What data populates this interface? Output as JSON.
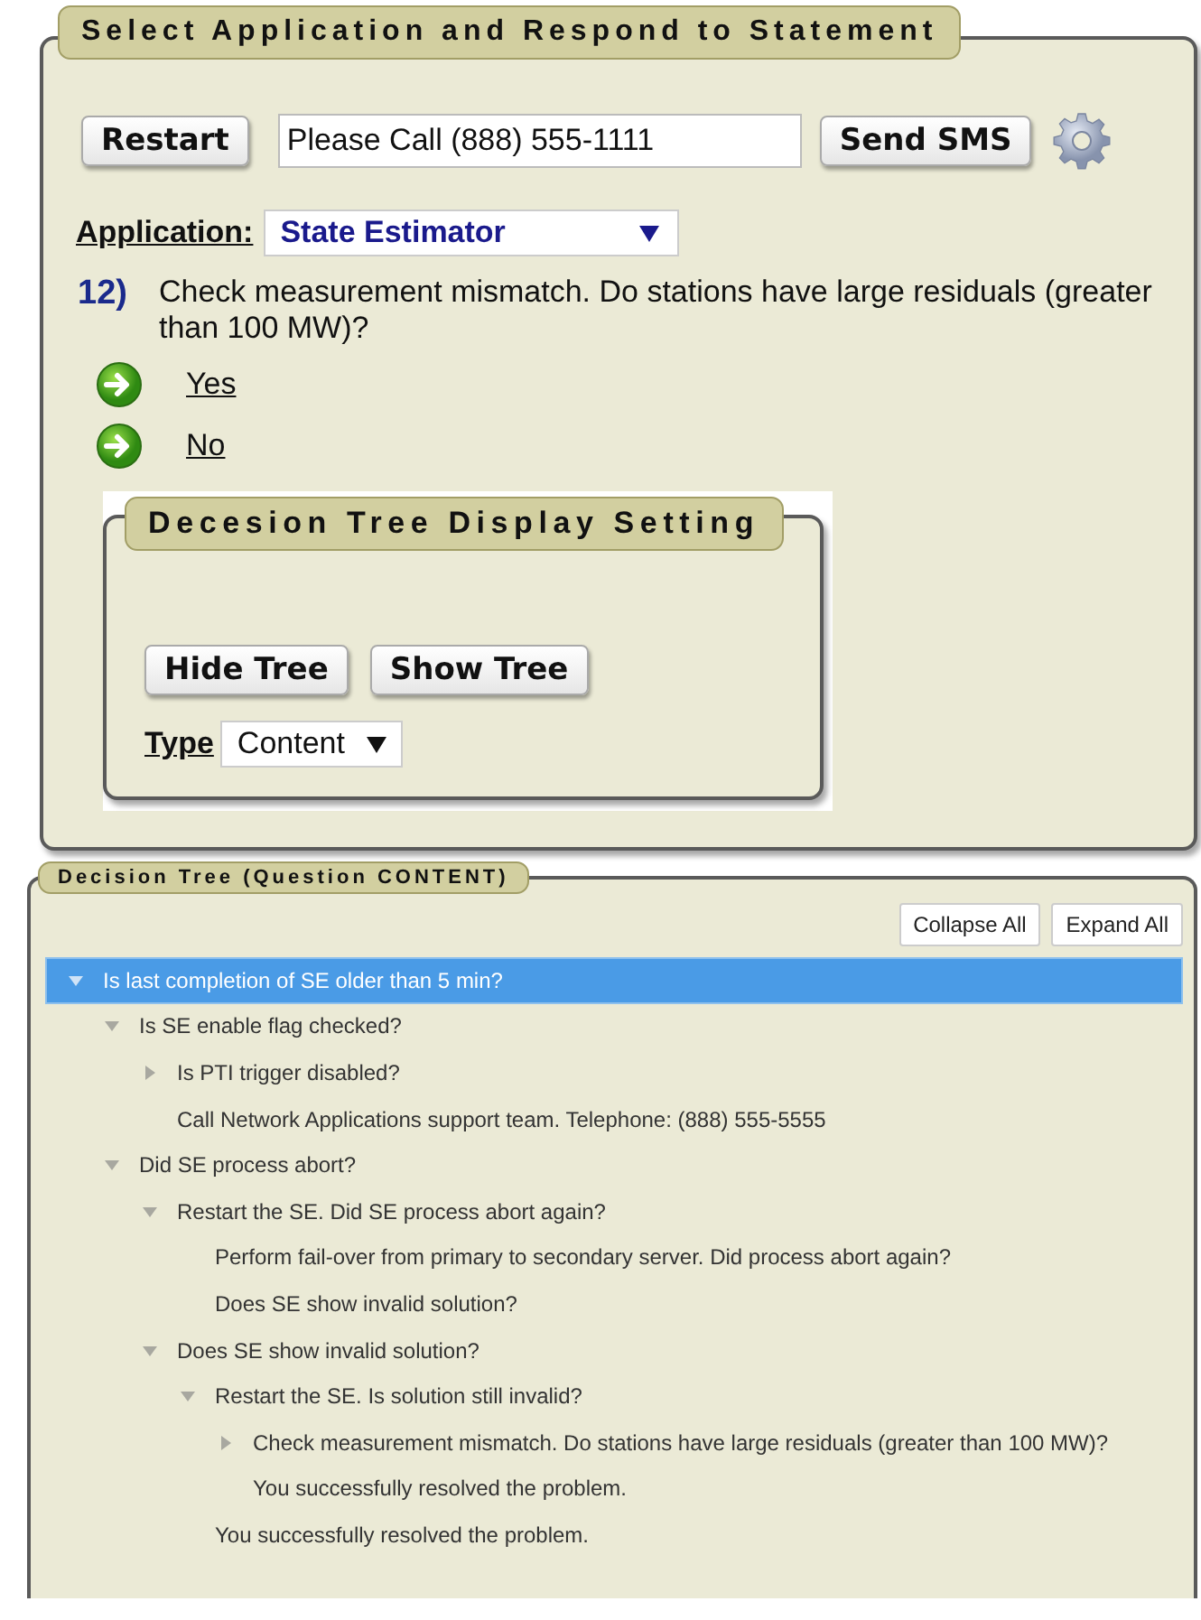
{
  "main_panel": {
    "title": "Select Application and Respond to Statement",
    "restart_button": "Restart",
    "message_field": {
      "value": "Please Call (888) 555-1111"
    },
    "send_button": "Send SMS",
    "application": {
      "label": "Application:",
      "value": "State Estimator"
    },
    "question": {
      "number": "12)",
      "text": "Check measurement mismatch. Do stations have large residuals (greater than 100 MW)?"
    },
    "answers": [
      "Yes",
      "No"
    ],
    "display_setting": {
      "title": "Decesion Tree Display Setting",
      "buttons": [
        "Hide Tree",
        "Show Tree"
      ],
      "type": {
        "label": "Type",
        "value": "Content"
      }
    }
  },
  "tree_panel": {
    "title": "Decision Tree (Question CONTENT)",
    "buttons": [
      "Collapse All",
      "Expand All"
    ],
    "nodes": [
      {
        "text": "Is last completion of SE older than 5 min?",
        "selected": true,
        "expanded": true,
        "children": [
          {
            "text": "Is SE enable flag checked?",
            "selected": false,
            "expanded": true,
            "children": [
              {
                "text": "Is PTI trigger disabled?",
                "selected": false,
                "expanded": false
              },
              {
                "text": "Call Network Applications support team. Telephone: (888) 555-5555",
                "selected": false
              }
            ]
          },
          {
            "text": "Did SE process abort?",
            "selected": false,
            "expanded": true,
            "children": [
              {
                "text": "Restart the SE. Did SE process abort again?",
                "selected": false,
                "expanded": true,
                "children": [
                  {
                    "text": "Perform fail-over from primary to secondary server. Did process abort again?",
                    "selected": false
                  },
                  {
                    "text": "Does SE show invalid solution?",
                    "selected": false
                  }
                ]
              },
              {
                "text": "Does SE show invalid solution?",
                "selected": false,
                "expanded": true,
                "children": [
                  {
                    "text": "Restart the SE. Is solution still invalid?",
                    "selected": false,
                    "expanded": true,
                    "children": [
                      {
                        "text": "Check measurement mismatch. Do stations have large residuals (greater than 100 MW)?",
                        "selected": false,
                        "expanded": false
                      },
                      {
                        "text": "You successfully resolved the problem.",
                        "selected": false
                      }
                    ]
                  },
                  {
                    "text": "You successfully resolved the problem.",
                    "selected": false
                  }
                ]
              }
            ]
          }
        ]
      }
    ]
  }
}
